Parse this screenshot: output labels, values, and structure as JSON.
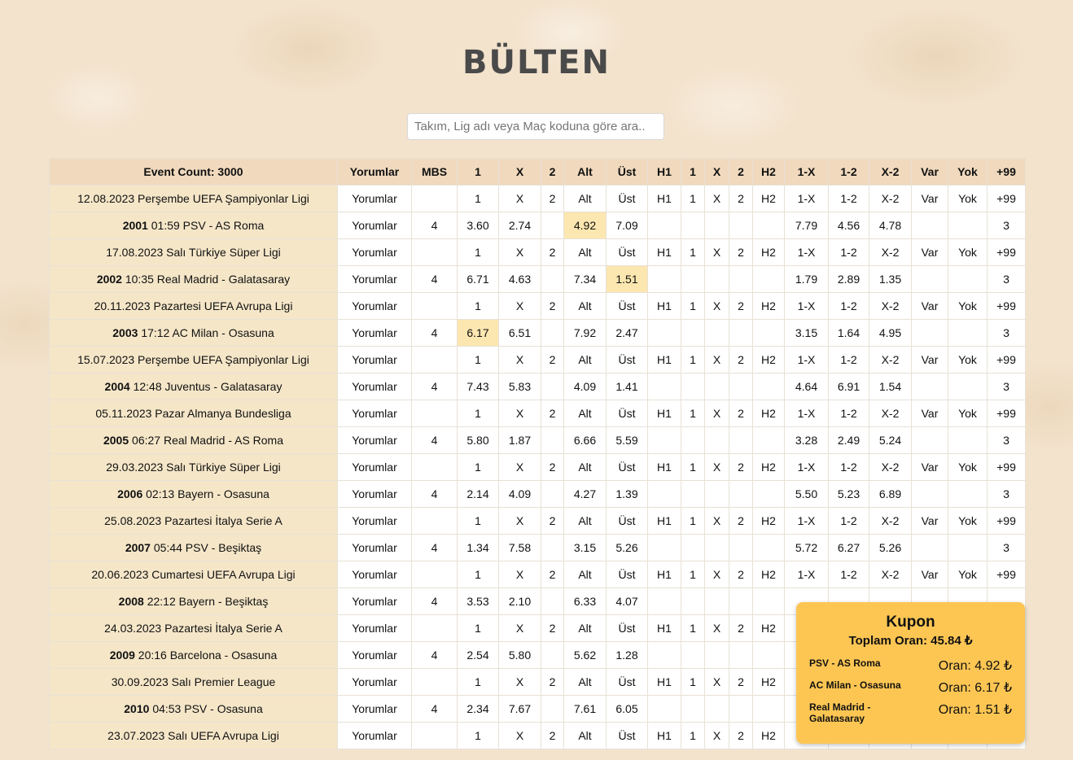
{
  "header": {
    "title": "BÜLTEN"
  },
  "search": {
    "placeholder": "Takım, Lig adı veya Maç koduna göre ara.."
  },
  "table": {
    "columns": [
      "Event Count: 3000",
      "Yorumlar",
      "MBS",
      "1",
      "X",
      "2",
      "Alt",
      "Üst",
      "H1",
      "1",
      "X",
      "2",
      "H2",
      "1-X",
      "1-2",
      "X-2",
      "Var",
      "Yok",
      "+99"
    ],
    "rows": [
      {
        "type": "league",
        "event": "12.08.2023 Perşembe UEFA Şampiyonlar Ligi",
        "cells": [
          "Yorumlar",
          "",
          "1",
          "X",
          "2",
          "Alt",
          "Üst",
          "H1",
          "1",
          "X",
          "2",
          "H2",
          "1-X",
          "1-2",
          "X-2",
          "Var",
          "Yok",
          "+99"
        ]
      },
      {
        "type": "match",
        "code": "2001",
        "event": "01:59 PSV - AS Roma",
        "cells": [
          "Yorumlar",
          "4",
          "3.60",
          "2.74",
          "",
          "4.92",
          "7.09",
          "",
          "",
          "",
          "",
          "",
          "7.79",
          "4.56",
          "4.78",
          "",
          "",
          "3"
        ],
        "hl": 5
      },
      {
        "type": "league",
        "event": "17.08.2023 Salı Türkiye Süper Ligi",
        "cells": [
          "Yorumlar",
          "",
          "1",
          "X",
          "2",
          "Alt",
          "Üst",
          "H1",
          "1",
          "X",
          "2",
          "H2",
          "1-X",
          "1-2",
          "X-2",
          "Var",
          "Yok",
          "+99"
        ]
      },
      {
        "type": "match",
        "code": "2002",
        "event": "10:35 Real Madrid - Galatasaray",
        "cells": [
          "Yorumlar",
          "4",
          "6.71",
          "4.63",
          "",
          "7.34",
          "1.51",
          "",
          "",
          "",
          "",
          "",
          "1.79",
          "2.89",
          "1.35",
          "",
          "",
          "3"
        ],
        "hl": 6
      },
      {
        "type": "league",
        "event": "20.11.2023 Pazartesi UEFA Avrupa Ligi",
        "cells": [
          "Yorumlar",
          "",
          "1",
          "X",
          "2",
          "Alt",
          "Üst",
          "H1",
          "1",
          "X",
          "2",
          "H2",
          "1-X",
          "1-2",
          "X-2",
          "Var",
          "Yok",
          "+99"
        ]
      },
      {
        "type": "match",
        "code": "2003",
        "event": "17:12 AC Milan - Osasuna",
        "cells": [
          "Yorumlar",
          "4",
          "6.17",
          "6.51",
          "",
          "7.92",
          "2.47",
          "",
          "",
          "",
          "",
          "",
          "3.15",
          "1.64",
          "4.95",
          "",
          "",
          "3"
        ],
        "hl": 2
      },
      {
        "type": "league",
        "event": "15.07.2023 Perşembe UEFA Şampiyonlar Ligi",
        "cells": [
          "Yorumlar",
          "",
          "1",
          "X",
          "2",
          "Alt",
          "Üst",
          "H1",
          "1",
          "X",
          "2",
          "H2",
          "1-X",
          "1-2",
          "X-2",
          "Var",
          "Yok",
          "+99"
        ]
      },
      {
        "type": "match",
        "code": "2004",
        "event": "12:48 Juventus - Galatasaray",
        "cells": [
          "Yorumlar",
          "4",
          "7.43",
          "5.83",
          "",
          "4.09",
          "1.41",
          "",
          "",
          "",
          "",
          "",
          "4.64",
          "6.91",
          "1.54",
          "",
          "",
          "3"
        ]
      },
      {
        "type": "league",
        "event": "05.11.2023 Pazar Almanya Bundesliga",
        "cells": [
          "Yorumlar",
          "",
          "1",
          "X",
          "2",
          "Alt",
          "Üst",
          "H1",
          "1",
          "X",
          "2",
          "H2",
          "1-X",
          "1-2",
          "X-2",
          "Var",
          "Yok",
          "+99"
        ]
      },
      {
        "type": "match",
        "code": "2005",
        "event": "06:27 Real Madrid - AS Roma",
        "cells": [
          "Yorumlar",
          "4",
          "5.80",
          "1.87",
          "",
          "6.66",
          "5.59",
          "",
          "",
          "",
          "",
          "",
          "3.28",
          "2.49",
          "5.24",
          "",
          "",
          "3"
        ]
      },
      {
        "type": "league",
        "event": "29.03.2023 Salı Türkiye Süper Ligi",
        "cells": [
          "Yorumlar",
          "",
          "1",
          "X",
          "2",
          "Alt",
          "Üst",
          "H1",
          "1",
          "X",
          "2",
          "H2",
          "1-X",
          "1-2",
          "X-2",
          "Var",
          "Yok",
          "+99"
        ]
      },
      {
        "type": "match",
        "code": "2006",
        "event": "02:13 Bayern - Osasuna",
        "cells": [
          "Yorumlar",
          "4",
          "2.14",
          "4.09",
          "",
          "4.27",
          "1.39",
          "",
          "",
          "",
          "",
          "",
          "5.50",
          "5.23",
          "6.89",
          "",
          "",
          "3"
        ]
      },
      {
        "type": "league",
        "event": "25.08.2023 Pazartesi İtalya Serie A",
        "cells": [
          "Yorumlar",
          "",
          "1",
          "X",
          "2",
          "Alt",
          "Üst",
          "H1",
          "1",
          "X",
          "2",
          "H2",
          "1-X",
          "1-2",
          "X-2",
          "Var",
          "Yok",
          "+99"
        ]
      },
      {
        "type": "match",
        "code": "2007",
        "event": "05:44 PSV - Beşiktaş",
        "cells": [
          "Yorumlar",
          "4",
          "1.34",
          "7.58",
          "",
          "3.15",
          "5.26",
          "",
          "",
          "",
          "",
          "",
          "5.72",
          "6.27",
          "5.26",
          "",
          "",
          "3"
        ]
      },
      {
        "type": "league",
        "event": "20.06.2023 Cumartesi UEFA Avrupa Ligi",
        "cells": [
          "Yorumlar",
          "",
          "1",
          "X",
          "2",
          "Alt",
          "Üst",
          "H1",
          "1",
          "X",
          "2",
          "H2",
          "1-X",
          "1-2",
          "X-2",
          "Var",
          "Yok",
          "+99"
        ]
      },
      {
        "type": "match",
        "code": "2008",
        "event": "22:12 Bayern - Beşiktaş",
        "cells": [
          "Yorumlar",
          "4",
          "3.53",
          "2.10",
          "",
          "6.33",
          "4.07",
          "",
          "",
          "",
          "",
          "",
          "",
          "",
          "",
          "",
          "",
          ""
        ]
      },
      {
        "type": "league",
        "event": "24.03.2023 Pazartesi İtalya Serie A",
        "cells": [
          "Yorumlar",
          "",
          "1",
          "X",
          "2",
          "Alt",
          "Üst",
          "H1",
          "1",
          "X",
          "2",
          "H2",
          "",
          "",
          "",
          "",
          "",
          ""
        ]
      },
      {
        "type": "match",
        "code": "2009",
        "event": "20:16 Barcelona - Osasuna",
        "cells": [
          "Yorumlar",
          "4",
          "2.54",
          "5.80",
          "",
          "5.62",
          "1.28",
          "",
          "",
          "",
          "",
          "",
          "",
          "",
          "",
          "",
          "",
          ""
        ]
      },
      {
        "type": "league",
        "event": "30.09.2023 Salı Premier League",
        "cells": [
          "Yorumlar",
          "",
          "1",
          "X",
          "2",
          "Alt",
          "Üst",
          "H1",
          "1",
          "X",
          "2",
          "H2",
          "",
          "",
          "",
          "",
          "",
          ""
        ]
      },
      {
        "type": "match",
        "code": "2010",
        "event": "04:53 PSV - Osasuna",
        "cells": [
          "Yorumlar",
          "4",
          "2.34",
          "7.67",
          "",
          "7.61",
          "6.05",
          "",
          "",
          "",
          "",
          "",
          "",
          "",
          "",
          "",
          "",
          ""
        ]
      },
      {
        "type": "league",
        "event": "23.07.2023 Salı UEFA Avrupa Ligi",
        "cells": [
          "Yorumlar",
          "",
          "1",
          "X",
          "2",
          "Alt",
          "Üst",
          "H1",
          "1",
          "X",
          "2",
          "H2",
          "",
          "",
          "",
          "",
          "",
          ""
        ]
      }
    ]
  },
  "kupon": {
    "title": "Kupon",
    "total": "Toplam Oran: 45.84 ₺",
    "items": [
      {
        "match": "PSV - AS Roma",
        "odd": "Oran: 4.92 ₺"
      },
      {
        "match": "AC Milan - Osasuna",
        "odd": "Oran: 6.17 ₺"
      },
      {
        "match": "Real Madrid - Galatasaray",
        "odd": "Oran: 1.51 ₺"
      }
    ]
  },
  "colors": {
    "header_row": "#f0d9bd",
    "event_cell": "#f5e6c8",
    "selected_odd": "#fce7b0",
    "kupon_bg": "#fdc653"
  }
}
